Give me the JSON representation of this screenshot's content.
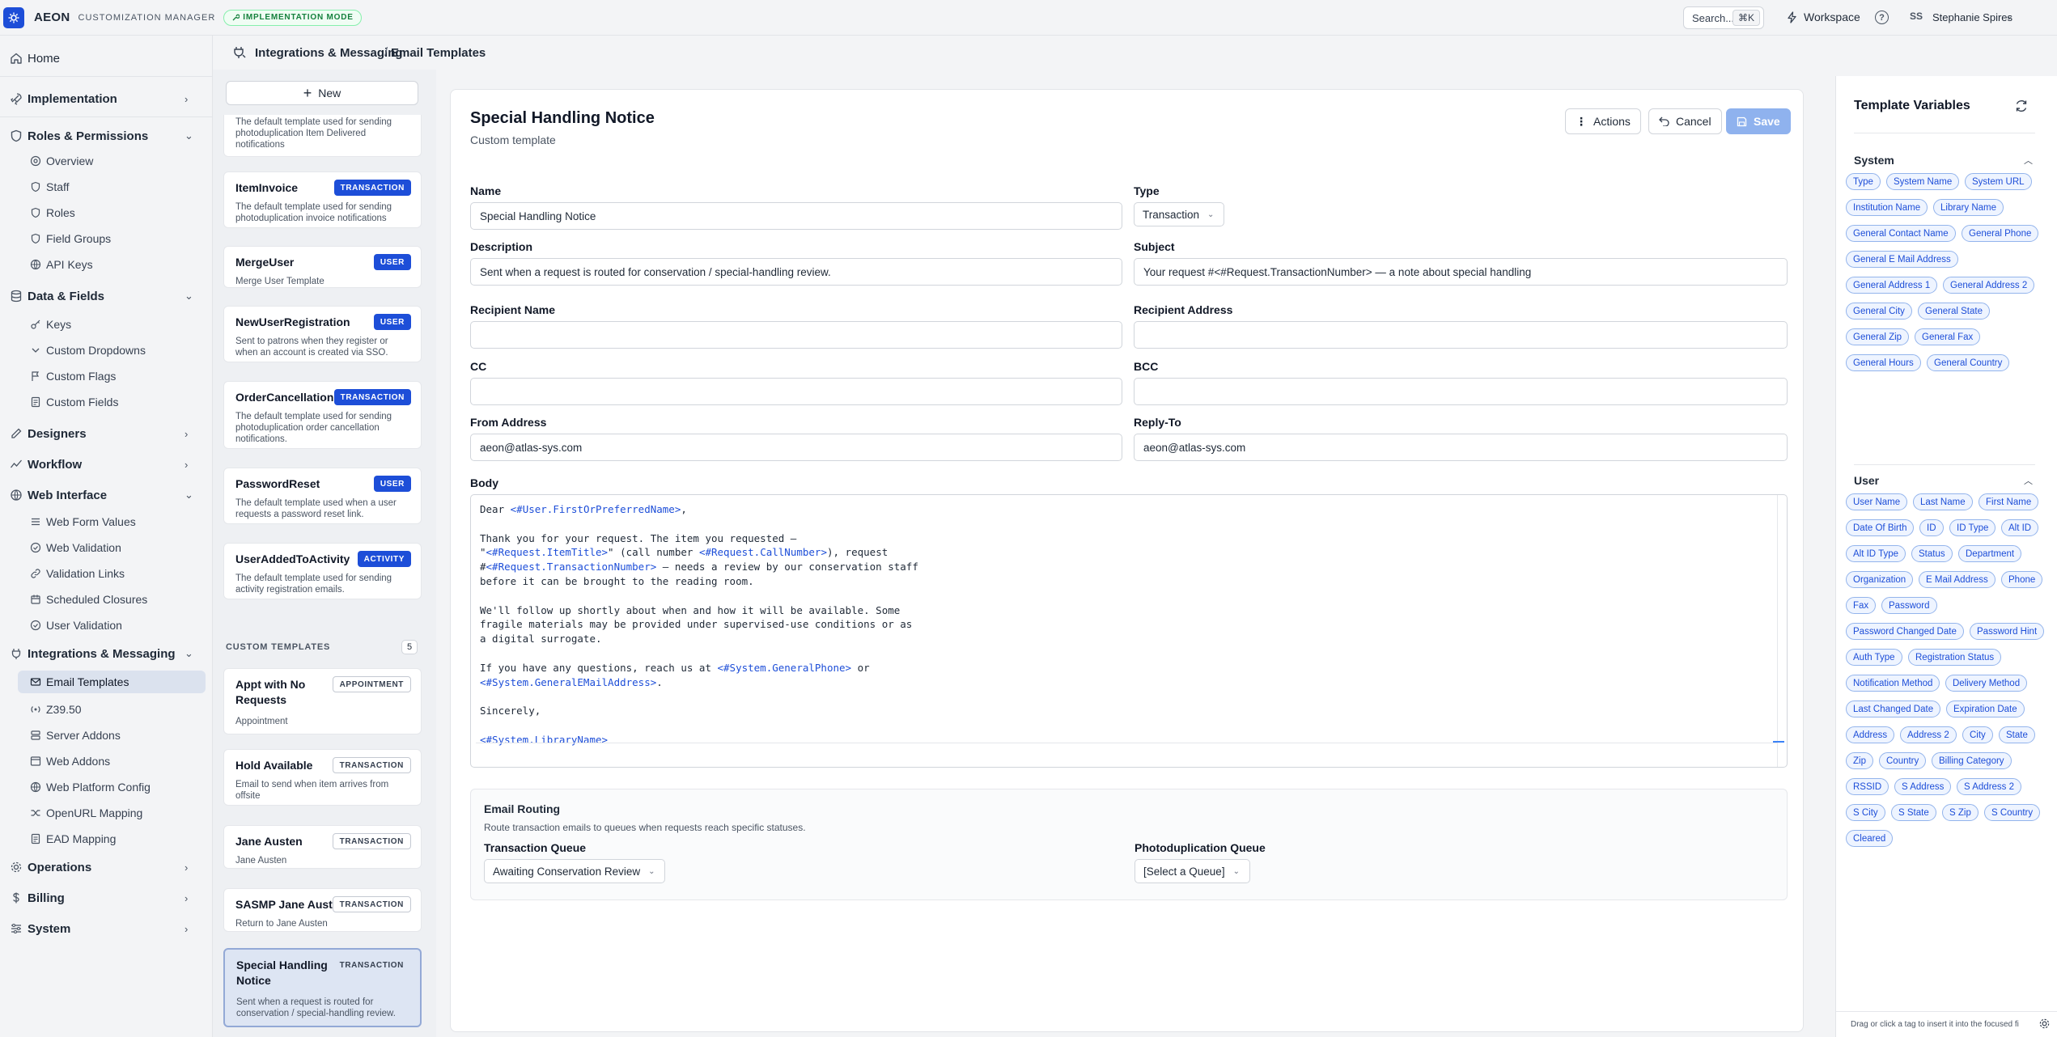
{
  "topbar": {
    "brand": "AEON",
    "brand_sub": "CUSTOMIZATION MANAGER",
    "mode_badge": "IMPLEMENTATION MODE",
    "search_label": "Search...",
    "search_kbd": "⌘K",
    "workspace_label": "Workspace",
    "user_initials": "SS",
    "user_name": "Stephanie Spires"
  },
  "nav": {
    "home": "Home",
    "implementation": "Implementation",
    "roles": "Roles & Permissions",
    "roles_items": [
      "Overview",
      "Staff",
      "Roles",
      "Field Groups",
      "API Keys"
    ],
    "data": "Data & Fields",
    "data_items": [
      "Keys",
      "Custom Dropdowns",
      "Custom Flags",
      "Custom Fields"
    ],
    "designers": "Designers",
    "workflow": "Workflow",
    "web": "Web Interface",
    "web_items": [
      "Web Form Values",
      "Web Validation",
      "Validation Links",
      "Scheduled Closures",
      "User Validation"
    ],
    "integrations": "Integrations & Messaging",
    "integrations_items": [
      "Email Templates",
      "Z39.50",
      "Server Addons",
      "Web Addons",
      "Web Platform Config",
      "OpenURL Mapping",
      "EAD Mapping"
    ],
    "operations": "Operations",
    "billing": "Billing",
    "system": "System"
  },
  "breadcrumb": {
    "section": "Integrations & Messaging",
    "separator": "/",
    "page": "Email Templates"
  },
  "templates": {
    "new_label": "New",
    "custom_heading": "CUSTOM TEMPLATES",
    "custom_count": "5",
    "system_items": [
      {
        "name": "",
        "badge": "",
        "desc": [
          "The default template used for sending",
          "photoduplication Item Delivered",
          "notifications"
        ]
      },
      {
        "name": "ItemInvoice",
        "badge": "TRANSACTION",
        "desc": [
          "The default template used for sending",
          "photoduplication invoice notifications"
        ]
      },
      {
        "name": "MergeUser",
        "badge": "USER",
        "desc": [
          "Merge User Template"
        ]
      },
      {
        "name": "NewUserRegistration",
        "badge": "USER",
        "desc": [
          "Sent to patrons when they register or",
          "when an account is created via SSO."
        ]
      },
      {
        "name": "OrderCancellation",
        "badge": "TRANSACTION",
        "desc": [
          "The default template used for sending",
          "photoduplication order cancellation",
          "notifications."
        ]
      },
      {
        "name": "PasswordReset",
        "badge": "USER",
        "desc": [
          "The default template used when a user",
          "requests a password reset link."
        ]
      },
      {
        "name": "UserAddedToActivity",
        "badge": "ACTIVITY",
        "desc": [
          "The default template used for sending",
          "activity registration emails."
        ]
      }
    ],
    "custom_items": [
      {
        "name": [
          "Appt with No",
          "Requests"
        ],
        "badge": "APPOINTMENT",
        "desc": [
          "Appointment"
        ]
      },
      {
        "name": [
          "Hold Available"
        ],
        "badge": "TRANSACTION",
        "desc": [
          "Email to send when item arrives from",
          "offsite"
        ]
      },
      {
        "name": [
          "Jane Austen"
        ],
        "badge": "TRANSACTION",
        "desc": [
          "Jane Austen"
        ]
      },
      {
        "name": [
          "SASMP Jane Austen"
        ],
        "badge": "TRANSACTION",
        "desc": [
          "Return to Jane Austen"
        ]
      },
      {
        "name": [
          "Special Handling",
          "Notice"
        ],
        "badge": "TRANSACTION",
        "desc": [
          "Sent when a request is routed for",
          "conservation / special-handling review."
        ]
      }
    ]
  },
  "editor": {
    "title": "Special Handling Notice",
    "subtitle": "Custom template",
    "actions_label": "Actions",
    "cancel_label": "Cancel",
    "save_label": "Save",
    "name_label": "Name",
    "name_value": "Special Handling Notice",
    "type_label": "Type",
    "type_value": "Transaction",
    "description_label": "Description",
    "description_value": "Sent when a request is routed for conservation / special-handling review.",
    "subject_label": "Subject",
    "subject_value": "Your request #<#Request.TransactionNumber> — a note about special handling",
    "recipient_name_label": "Recipient Name",
    "recipient_name_value": "",
    "recipient_address_label": "Recipient Address",
    "recipient_address_value": "",
    "cc_label": "CC",
    "cc_value": "",
    "bcc_label": "BCC",
    "bcc_value": "",
    "from_label": "From Address",
    "from_value": "aeon@atlas-sys.com",
    "replyto_label": "Reply-To",
    "replyto_value": "aeon@atlas-sys.com",
    "body_label": "Body",
    "body_lines": [
      [
        [
          "t",
          "Dear "
        ],
        [
          "k",
          "<#User.FirstOrPreferredName>"
        ],
        [
          "t",
          ","
        ]
      ],
      [],
      [
        [
          "t",
          "Thank you for your request. The item you requested —"
        ]
      ],
      [
        [
          "t",
          "\""
        ],
        [
          "k",
          "<#Request.ItemTitle>"
        ],
        [
          "t",
          "\" (call number "
        ],
        [
          "k",
          "<#Request.CallNumber>"
        ],
        [
          "t",
          "), request"
        ]
      ],
      [
        [
          "t",
          "#"
        ],
        [
          "k",
          "<#Request.TransactionNumber>"
        ],
        [
          "t",
          " — needs a review by our conservation staff"
        ]
      ],
      [
        [
          "t",
          "before it can be brought to the reading room."
        ]
      ],
      [],
      [
        [
          "t",
          "We'll follow up shortly about when and how it will be available. Some"
        ]
      ],
      [
        [
          "t",
          "fragile materials may be provided under supervised-use conditions or as"
        ]
      ],
      [
        [
          "t",
          "a digital surrogate."
        ]
      ],
      [],
      [
        [
          "t",
          "If you have any questions, reach us at "
        ],
        [
          "k",
          "<#System.GeneralPhone>"
        ],
        [
          "t",
          " or"
        ]
      ],
      [
        [
          "k",
          "<#System.GeneralEMailAddress>"
        ],
        [
          "t",
          "."
        ]
      ],
      [],
      [
        [
          "t",
          "Sincerely,"
        ]
      ],
      [],
      [
        [
          "k",
          "<#System.LibraryName>"
        ]
      ]
    ],
    "routing_title": "Email Routing",
    "routing_sub": "Route transaction emails to queues when requests reach specific statuses.",
    "tq_label": "Transaction Queue",
    "tq_value": "Awaiting Conservation Review",
    "pq_label": "Photoduplication Queue",
    "pq_value": "[Select a Queue]"
  },
  "variables": {
    "title": "Template Variables",
    "system_title": "System",
    "system_tags": [
      "Type",
      "System Name",
      "System URL",
      "Institution Name",
      "Library Name",
      "General Contact Name",
      "General Phone",
      "General E Mail Address",
      "General Address 1",
      "General Address 2",
      "General City",
      "General State",
      "General Zip",
      "General Fax",
      "General Hours",
      "General Country"
    ],
    "user_title": "User",
    "user_tags": [
      "User Name",
      "Last Name",
      "First Name",
      "Date Of Birth",
      "ID",
      "ID Type",
      "Alt ID",
      "Alt ID Type",
      "Status",
      "Department",
      "Organization",
      "E Mail Address",
      "Phone",
      "Fax",
      "Password",
      "Password Changed Date",
      "Password Hint",
      "Auth Type",
      "Registration Status",
      "Notification Method",
      "Delivery Method",
      "Last Changed Date",
      "Expiration Date",
      "Address",
      "Address 2",
      "City",
      "State",
      "Zip",
      "Country",
      "Billing Category",
      "RSSID",
      "S Address",
      "S Address 2",
      "S City",
      "S State",
      "S Zip",
      "S Country",
      "Cleared"
    ],
    "footer": "Drag or click a tag to insert it into the focused fi"
  }
}
